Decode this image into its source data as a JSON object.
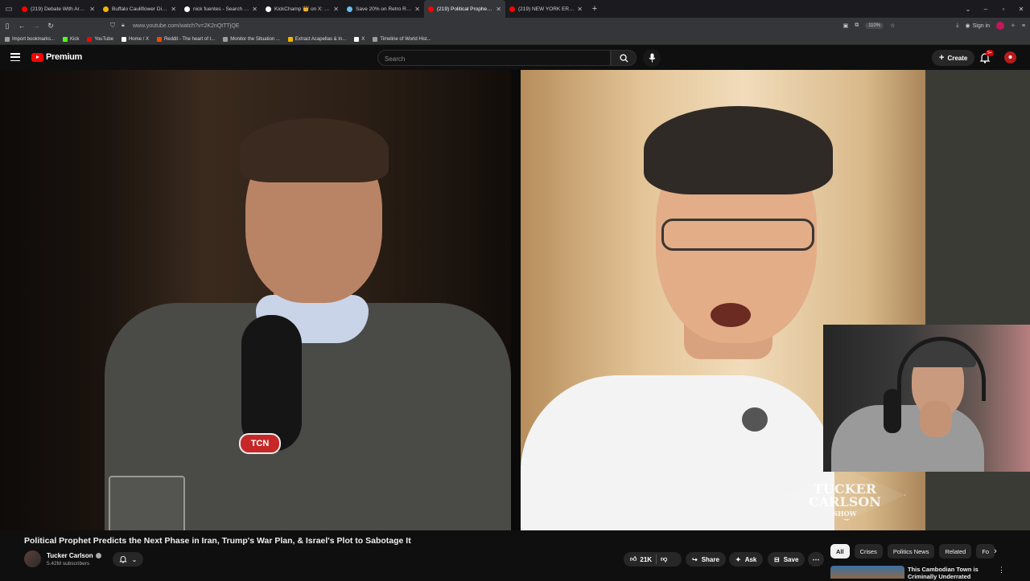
{
  "browser": {
    "tabs": [
      {
        "label": "(219) Debate With Arnab LIVE:",
        "favicon_color": "#ff0000",
        "active": false
      },
      {
        "label": "Buffalo Cauliflower Dip - Gimm",
        "favicon_color": "#f4b400",
        "active": false
      },
      {
        "label": "nick fuentes - Search / X",
        "favicon_color": "#ffffff",
        "active": false
      },
      {
        "label": "KickChamp 👑 on X: \"Clavi",
        "favicon_color": "#ffffff",
        "active": false
      },
      {
        "label": "Save 20% on Retro Rewind - Vi",
        "favicon_color": "#66c0f4",
        "active": false
      },
      {
        "label": "(219) Political Prophet Pred",
        "favicon_color": "#ff0000",
        "active": true
      },
      {
        "label": "(219) NEW YORK ERUPTS: Prote",
        "favicon_color": "#ff0000",
        "active": false
      }
    ],
    "new_tab": "+",
    "url": "www.youtube.com/watch?v=2K2nQtTTjQE",
    "zoom": "110%",
    "sign_in": "Sign in",
    "bookmarks": [
      {
        "label": "Import bookmarks...",
        "color": "#9e9e9e"
      },
      {
        "label": "Kick",
        "color": "#53fc18"
      },
      {
        "label": "YouTube",
        "color": "#ff0000"
      },
      {
        "label": "Home / X",
        "color": "#ffffff"
      },
      {
        "label": "Reddit - The heart of t...",
        "color": "#ff4500"
      },
      {
        "label": "Monitor the Situation ...",
        "color": "#9e9e9e"
      },
      {
        "label": "Extract Acapellas & In...",
        "color": "#f4b400"
      },
      {
        "label": "X",
        "color": "#ffffff"
      },
      {
        "label": "Timeline of World Hist...",
        "color": "#9e9e9e"
      }
    ]
  },
  "header": {
    "logo_text": "Premium",
    "search_placeholder": "Search",
    "create_label": "Create",
    "notification_count": "9+"
  },
  "video": {
    "watermark": {
      "line1": "TUCKER",
      "line2": "CARLSON",
      "line3": "SHOW"
    },
    "mic_logo": "TCN",
    "title": "Political Prophet Predicts the Next Phase in Iran, Trump's War Plan, & Israel's Plot to Sabotage It"
  },
  "channel": {
    "name": "Tucker Carlson",
    "subscribers": "5.42M subscribers"
  },
  "actions": {
    "likes": "21K",
    "share": "Share",
    "ask": "Ask",
    "save": "Save",
    "more": "⋯"
  },
  "chips": [
    "All",
    "Crises",
    "Politics News",
    "Related",
    "Fo"
  ],
  "recommendation": {
    "title": "This Cambodian Town is Criminally Underrated"
  }
}
